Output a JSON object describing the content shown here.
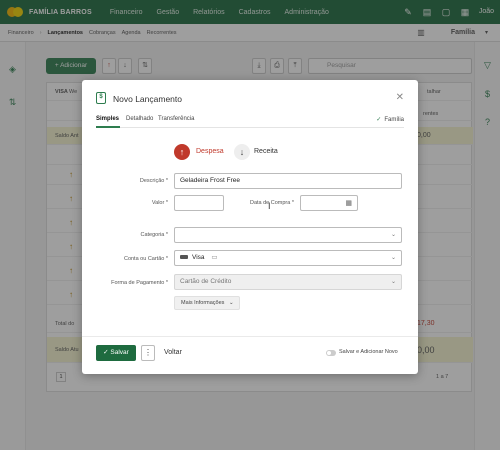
{
  "topnav": {
    "brand": "FAMÍLIA BARROS",
    "items": [
      "Financeiro",
      "Gestão",
      "Relatórios",
      "Cadastros",
      "Administração"
    ],
    "user": "João"
  },
  "subnav": {
    "items": [
      "Financeiro",
      "Lançamentos",
      "Cobranças",
      "Agenda",
      "Recorrentes"
    ],
    "active_index": 1,
    "family": "Família"
  },
  "background": {
    "add_label": "+ Adicionar",
    "search_placeholder": "Pesquisar",
    "card_label": "VISA",
    "card_name": "We",
    "saldo_label": "Saldo Ant",
    "saldo_value": "0,00",
    "total_label": "Total do",
    "total_value": "17,30",
    "saldo_final_label": "Saldo Atu",
    "saldo_final_value": "0,00",
    "recorrentes": "rentes",
    "detalhar": "talhar",
    "pager_current": "1",
    "pager_info": "1 a 7"
  },
  "modal": {
    "title": "Novo Lançamento",
    "tabs": [
      "Simples",
      "Detalhado",
      "Transferência"
    ],
    "active_tab": 0,
    "family_label": "Família",
    "type_expense": "Despesa",
    "type_income": "Receita",
    "fields": {
      "descricao": {
        "label": "Descrição *",
        "value": "Geladeira Frost Free"
      },
      "valor": {
        "label": "Valor *",
        "value": ""
      },
      "data_compra": {
        "label": "Data de Compra *",
        "value": ""
      },
      "categoria": {
        "label": "Categoria *",
        "value": ""
      },
      "conta": {
        "label": "Conta ou Cartão *",
        "value": "Visa"
      },
      "forma": {
        "label": "Forma de Pagamento *",
        "value": "Cartão de Crédito"
      }
    },
    "more_info": "Mais Informações",
    "save": "Salvar",
    "back": "Voltar",
    "save_add_new": "Salvar e Adicionar Novo"
  }
}
